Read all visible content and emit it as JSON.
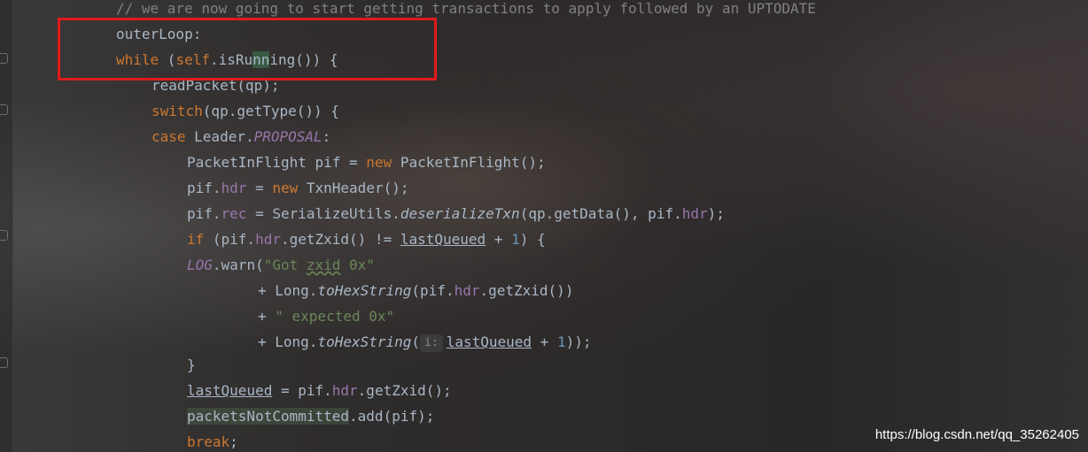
{
  "code": {
    "comment": "// we are now going to start getting transactions to apply followed by an UPTODATE",
    "outer_loop": "outerLoop:",
    "while_kw": "while",
    "while_open": " (",
    "self_kw": "self",
    "is_pre": ".isRu",
    "is_hl": "nn",
    "is_post": "ing()) {",
    "read_packet": "readPacket(qp);",
    "switch_kw": "switch",
    "switch_rest": "(qp.getType()) {",
    "case_kw": "case",
    "case_leader": " Leader.",
    "proposal": "PROPOSAL",
    "case_colon": ":",
    "pif_decl": "PacketInFlight pif = ",
    "new1": "new",
    "pif_ctor": " PacketInFlight();",
    "pif_hdr_pre": "pif.",
    "hdr": "hdr",
    "assign": " = ",
    "new2": "new",
    "txn_ctor": " TxnHeader();",
    "pif_rec_pre": "pif.",
    "rec": "rec",
    "ser_pre": " = SerializeUtils.",
    "deser": "deserializeTxn",
    "deser_args": "(qp.getData(), pif.",
    "hdr2": "hdr",
    "deser_end": ");",
    "if_kw": "if",
    "if_pre": " (pif.",
    "hdr3": "hdr",
    "if_mid": ".getZxid() != ",
    "last_queued": "lastQueued",
    "plus": " + ",
    "one": "1",
    "if_end": ") {",
    "log": "LOG",
    "warn": ".warn(",
    "str_got_a": "\"Got ",
    "str_got_zxid": "zxid",
    "str_got_b": " 0x\"",
    "plus_long": "+ Long.",
    "to_hex": "toHexString",
    "hex_args": "(pif.",
    "hdr4": "hdr",
    "hex_end": ".getZxid())",
    "plus_only": "+ ",
    "str_expected": "\" expected 0x\"",
    "param_hint": "i:",
    "last_queued2": "lastQueued",
    "plus2": " + ",
    "one2": "1",
    "hex_end2": "));",
    "close_brace": "}",
    "last_queued3": "lastQueued",
    "lq_assign": " = pif.",
    "hdr5": "hdr",
    "lq_end": ".getZxid();",
    "packets": "packetsNotCommitted",
    "packets_add": ".add(pif);",
    "break_kw": "break",
    "semicolon": ";"
  },
  "watermark": "https://blog.csdn.net/qq_35262405",
  "colors": {
    "keyword": "#cc7832",
    "field": "#9876aa",
    "string": "#6a8759",
    "number": "#6897bb",
    "text": "#a9b7c6",
    "comment": "#808080",
    "highlight_box": "#e11b1b"
  }
}
